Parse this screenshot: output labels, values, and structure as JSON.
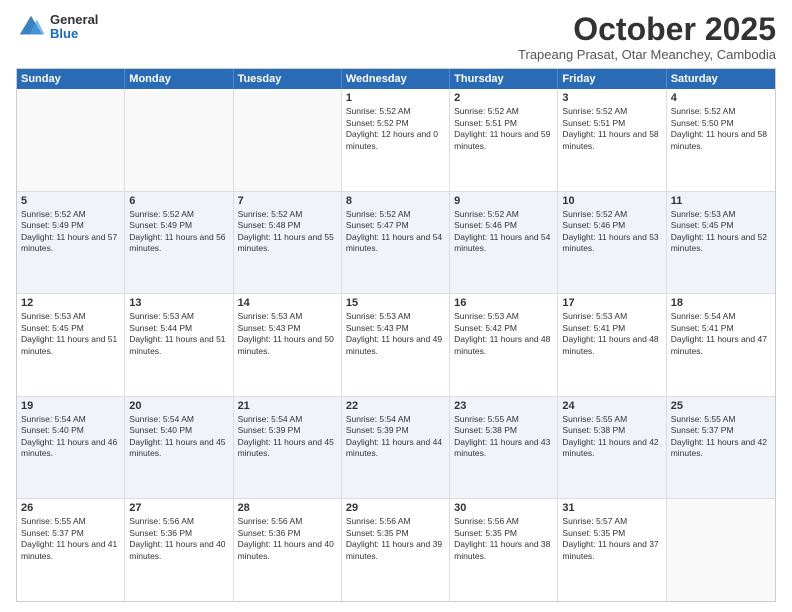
{
  "logo": {
    "general": "General",
    "blue": "Blue"
  },
  "header": {
    "month": "October 2025",
    "location": "Trapeang Prasat, Otar Meanchey, Cambodia"
  },
  "days_of_week": [
    "Sunday",
    "Monday",
    "Tuesday",
    "Wednesday",
    "Thursday",
    "Friday",
    "Saturday"
  ],
  "weeks": [
    [
      {
        "day": "",
        "sunrise": "",
        "sunset": "",
        "daylight": "",
        "empty": true
      },
      {
        "day": "",
        "sunrise": "",
        "sunset": "",
        "daylight": "",
        "empty": true
      },
      {
        "day": "",
        "sunrise": "",
        "sunset": "",
        "daylight": "",
        "empty": true
      },
      {
        "day": "1",
        "sunrise": "Sunrise: 5:52 AM",
        "sunset": "Sunset: 5:52 PM",
        "daylight": "Daylight: 12 hours and 0 minutes.",
        "empty": false
      },
      {
        "day": "2",
        "sunrise": "Sunrise: 5:52 AM",
        "sunset": "Sunset: 5:51 PM",
        "daylight": "Daylight: 11 hours and 59 minutes.",
        "empty": false
      },
      {
        "day": "3",
        "sunrise": "Sunrise: 5:52 AM",
        "sunset": "Sunset: 5:51 PM",
        "daylight": "Daylight: 11 hours and 58 minutes.",
        "empty": false
      },
      {
        "day": "4",
        "sunrise": "Sunrise: 5:52 AM",
        "sunset": "Sunset: 5:50 PM",
        "daylight": "Daylight: 11 hours and 58 minutes.",
        "empty": false
      }
    ],
    [
      {
        "day": "5",
        "sunrise": "Sunrise: 5:52 AM",
        "sunset": "Sunset: 5:49 PM",
        "daylight": "Daylight: 11 hours and 57 minutes.",
        "empty": false
      },
      {
        "day": "6",
        "sunrise": "Sunrise: 5:52 AM",
        "sunset": "Sunset: 5:49 PM",
        "daylight": "Daylight: 11 hours and 56 minutes.",
        "empty": false
      },
      {
        "day": "7",
        "sunrise": "Sunrise: 5:52 AM",
        "sunset": "Sunset: 5:48 PM",
        "daylight": "Daylight: 11 hours and 55 minutes.",
        "empty": false
      },
      {
        "day": "8",
        "sunrise": "Sunrise: 5:52 AM",
        "sunset": "Sunset: 5:47 PM",
        "daylight": "Daylight: 11 hours and 54 minutes.",
        "empty": false
      },
      {
        "day": "9",
        "sunrise": "Sunrise: 5:52 AM",
        "sunset": "Sunset: 5:46 PM",
        "daylight": "Daylight: 11 hours and 54 minutes.",
        "empty": false
      },
      {
        "day": "10",
        "sunrise": "Sunrise: 5:52 AM",
        "sunset": "Sunset: 5:46 PM",
        "daylight": "Daylight: 11 hours and 53 minutes.",
        "empty": false
      },
      {
        "day": "11",
        "sunrise": "Sunrise: 5:53 AM",
        "sunset": "Sunset: 5:45 PM",
        "daylight": "Daylight: 11 hours and 52 minutes.",
        "empty": false
      }
    ],
    [
      {
        "day": "12",
        "sunrise": "Sunrise: 5:53 AM",
        "sunset": "Sunset: 5:45 PM",
        "daylight": "Daylight: 11 hours and 51 minutes.",
        "empty": false
      },
      {
        "day": "13",
        "sunrise": "Sunrise: 5:53 AM",
        "sunset": "Sunset: 5:44 PM",
        "daylight": "Daylight: 11 hours and 51 minutes.",
        "empty": false
      },
      {
        "day": "14",
        "sunrise": "Sunrise: 5:53 AM",
        "sunset": "Sunset: 5:43 PM",
        "daylight": "Daylight: 11 hours and 50 minutes.",
        "empty": false
      },
      {
        "day": "15",
        "sunrise": "Sunrise: 5:53 AM",
        "sunset": "Sunset: 5:43 PM",
        "daylight": "Daylight: 11 hours and 49 minutes.",
        "empty": false
      },
      {
        "day": "16",
        "sunrise": "Sunrise: 5:53 AM",
        "sunset": "Sunset: 5:42 PM",
        "daylight": "Daylight: 11 hours and 48 minutes.",
        "empty": false
      },
      {
        "day": "17",
        "sunrise": "Sunrise: 5:53 AM",
        "sunset": "Sunset: 5:41 PM",
        "daylight": "Daylight: 11 hours and 48 minutes.",
        "empty": false
      },
      {
        "day": "18",
        "sunrise": "Sunrise: 5:54 AM",
        "sunset": "Sunset: 5:41 PM",
        "daylight": "Daylight: 11 hours and 47 minutes.",
        "empty": false
      }
    ],
    [
      {
        "day": "19",
        "sunrise": "Sunrise: 5:54 AM",
        "sunset": "Sunset: 5:40 PM",
        "daylight": "Daylight: 11 hours and 46 minutes.",
        "empty": false
      },
      {
        "day": "20",
        "sunrise": "Sunrise: 5:54 AM",
        "sunset": "Sunset: 5:40 PM",
        "daylight": "Daylight: 11 hours and 45 minutes.",
        "empty": false
      },
      {
        "day": "21",
        "sunrise": "Sunrise: 5:54 AM",
        "sunset": "Sunset: 5:39 PM",
        "daylight": "Daylight: 11 hours and 45 minutes.",
        "empty": false
      },
      {
        "day": "22",
        "sunrise": "Sunrise: 5:54 AM",
        "sunset": "Sunset: 5:39 PM",
        "daylight": "Daylight: 11 hours and 44 minutes.",
        "empty": false
      },
      {
        "day": "23",
        "sunrise": "Sunrise: 5:55 AM",
        "sunset": "Sunset: 5:38 PM",
        "daylight": "Daylight: 11 hours and 43 minutes.",
        "empty": false
      },
      {
        "day": "24",
        "sunrise": "Sunrise: 5:55 AM",
        "sunset": "Sunset: 5:38 PM",
        "daylight": "Daylight: 11 hours and 42 minutes.",
        "empty": false
      },
      {
        "day": "25",
        "sunrise": "Sunrise: 5:55 AM",
        "sunset": "Sunset: 5:37 PM",
        "daylight": "Daylight: 11 hours and 42 minutes.",
        "empty": false
      }
    ],
    [
      {
        "day": "26",
        "sunrise": "Sunrise: 5:55 AM",
        "sunset": "Sunset: 5:37 PM",
        "daylight": "Daylight: 11 hours and 41 minutes.",
        "empty": false
      },
      {
        "day": "27",
        "sunrise": "Sunrise: 5:56 AM",
        "sunset": "Sunset: 5:36 PM",
        "daylight": "Daylight: 11 hours and 40 minutes.",
        "empty": false
      },
      {
        "day": "28",
        "sunrise": "Sunrise: 5:56 AM",
        "sunset": "Sunset: 5:36 PM",
        "daylight": "Daylight: 11 hours and 40 minutes.",
        "empty": false
      },
      {
        "day": "29",
        "sunrise": "Sunrise: 5:56 AM",
        "sunset": "Sunset: 5:35 PM",
        "daylight": "Daylight: 11 hours and 39 minutes.",
        "empty": false
      },
      {
        "day": "30",
        "sunrise": "Sunrise: 5:56 AM",
        "sunset": "Sunset: 5:35 PM",
        "daylight": "Daylight: 11 hours and 38 minutes.",
        "empty": false
      },
      {
        "day": "31",
        "sunrise": "Sunrise: 5:57 AM",
        "sunset": "Sunset: 5:35 PM",
        "daylight": "Daylight: 11 hours and 37 minutes.",
        "empty": false
      },
      {
        "day": "",
        "sunrise": "",
        "sunset": "",
        "daylight": "",
        "empty": true
      }
    ]
  ]
}
